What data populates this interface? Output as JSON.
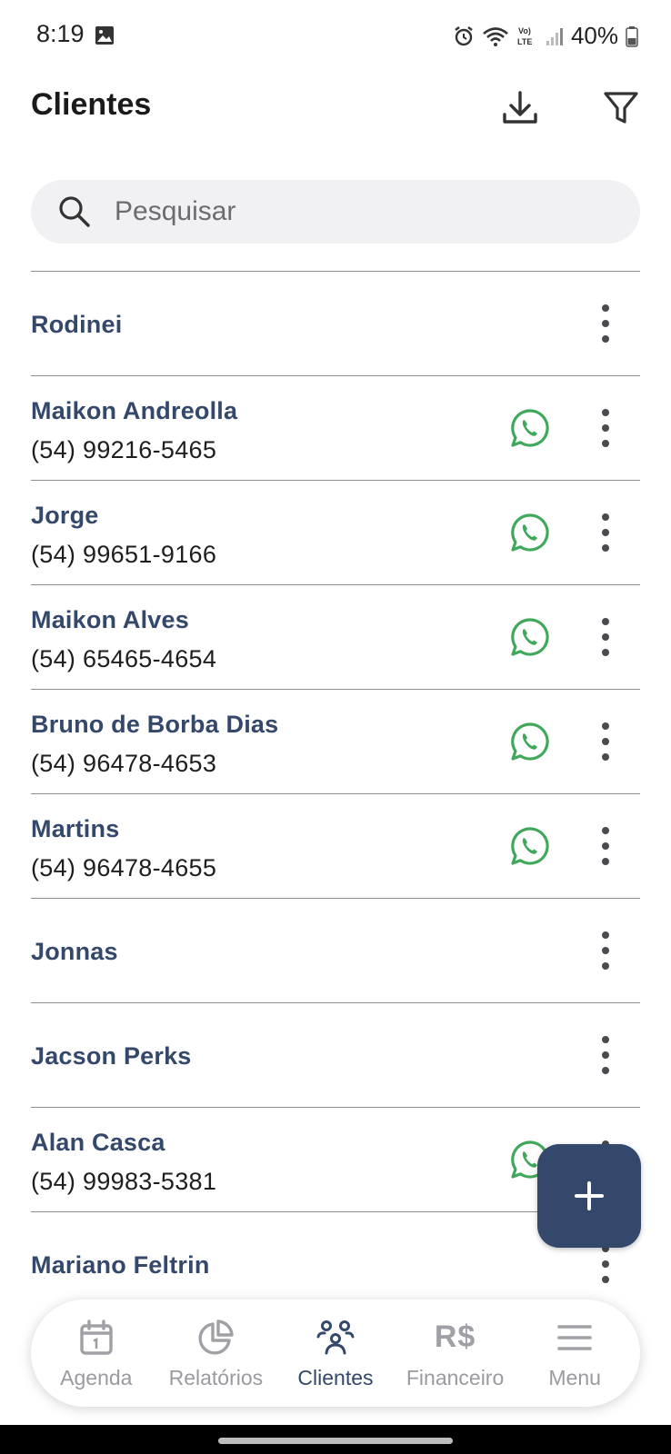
{
  "status_bar": {
    "time": "8:19",
    "battery": "40%",
    "network_label": "Vo) LTE"
  },
  "header": {
    "title": "Clientes",
    "download_icon": "download-icon",
    "filter_icon": "filter-icon"
  },
  "search": {
    "placeholder": "Pesquisar",
    "value": ""
  },
  "clients": [
    {
      "name": "Rodinei",
      "phone": ""
    },
    {
      "name": "Maikon Andreolla",
      "phone": "(54) 99216-5465"
    },
    {
      "name": "Jorge",
      "phone": "(54) 99651-9166"
    },
    {
      "name": "Maikon Alves",
      "phone": "(54) 65465-4654"
    },
    {
      "name": "Bruno de Borba Dias",
      "phone": "(54) 96478-4653"
    },
    {
      "name": "Martins",
      "phone": "(54) 96478-4655"
    },
    {
      "name": "Jonnas",
      "phone": ""
    },
    {
      "name": "Jacson Perks",
      "phone": ""
    },
    {
      "name": "Alan Casca",
      "phone": "(54) 99983-5381"
    },
    {
      "name": "Mariano Feltrin",
      "phone": ""
    }
  ],
  "fab": {
    "icon": "plus-icon"
  },
  "bottom_nav": {
    "items": [
      {
        "label": "Agenda",
        "icon": "calendar-icon"
      },
      {
        "label": "Relatórios",
        "icon": "pie-chart-icon"
      },
      {
        "label": "Clientes",
        "icon": "people-icon",
        "active": true
      },
      {
        "label": "Financeiro",
        "icon": "currency-icon",
        "glyph": "R$"
      },
      {
        "label": "Menu",
        "icon": "menu-icon"
      }
    ]
  },
  "colors": {
    "accent": "#34486b",
    "whatsapp": "#3fa85a",
    "inactive": "#9a9aa0"
  }
}
